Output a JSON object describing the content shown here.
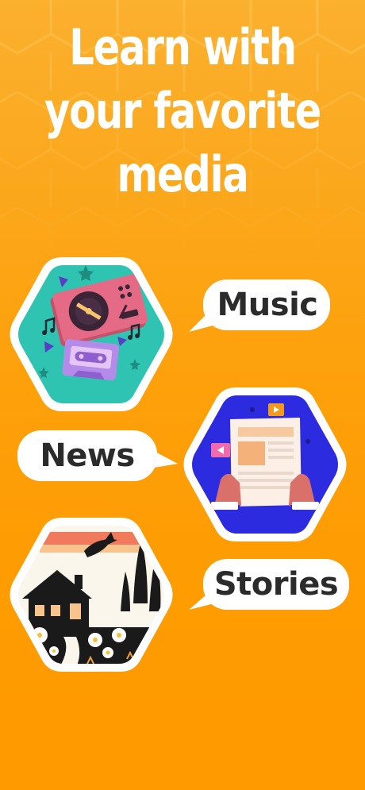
{
  "headline": {
    "line1": "Learn with",
    "line2": "your favorite",
    "line3": "media"
  },
  "colors": {
    "background": "#FFA000",
    "text_dark": "#2B2B2B",
    "white": "#FFFFFF",
    "music_bg": "#2FC4B2",
    "news_bg": "#2D2BE0"
  },
  "media": {
    "music": {
      "label": "Music",
      "icon": "turntable-cassette-illustration"
    },
    "news": {
      "label": "News",
      "icon": "newspaper-hands-illustration"
    },
    "stories": {
      "label": "Stories",
      "icon": "house-landscape-illustration"
    }
  }
}
